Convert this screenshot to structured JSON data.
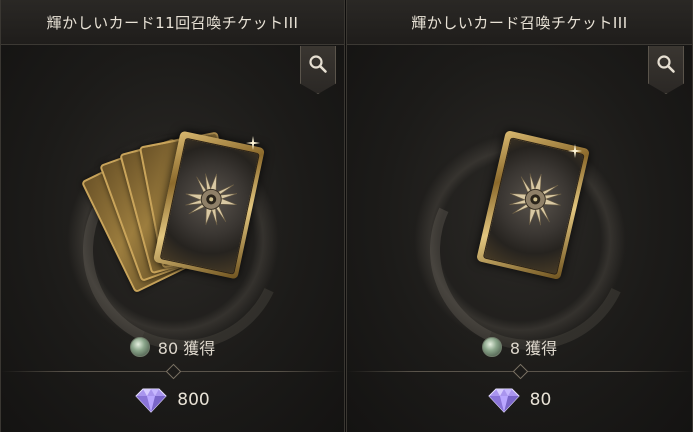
{
  "panels": [
    {
      "title": "輝かしいカード11回召喚チケットIII",
      "quantity_text": "80 獲得",
      "price": "800"
    },
    {
      "title": "輝かしいカード召喚チケットIII",
      "quantity_text": "8 獲得",
      "price": "80"
    }
  ],
  "icons": {
    "search": "magnifier-icon",
    "currency": "crystal-diamond-icon",
    "reward": "green-orb-icon"
  },
  "colors": {
    "title_text": "#e8e2d6",
    "card_gold": "#c9a45a",
    "diamond": "#b9a3ff"
  }
}
